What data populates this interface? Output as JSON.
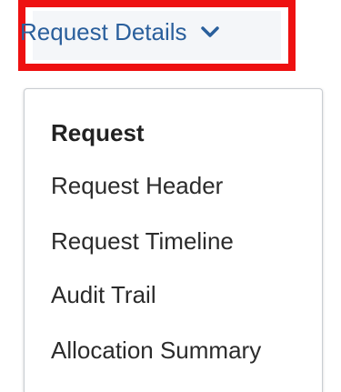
{
  "dropdown": {
    "label": "Request Details",
    "chevron_icon": "chevron-down-icon",
    "highlight_color": "#ee1111",
    "label_color": "#2a5f9c"
  },
  "menu": {
    "items": [
      {
        "label": "Request",
        "selected": true
      },
      {
        "label": "Request Header"
      },
      {
        "label": "Request Timeline"
      },
      {
        "label": "Audit Trail"
      },
      {
        "label": "Allocation Summary"
      }
    ]
  }
}
